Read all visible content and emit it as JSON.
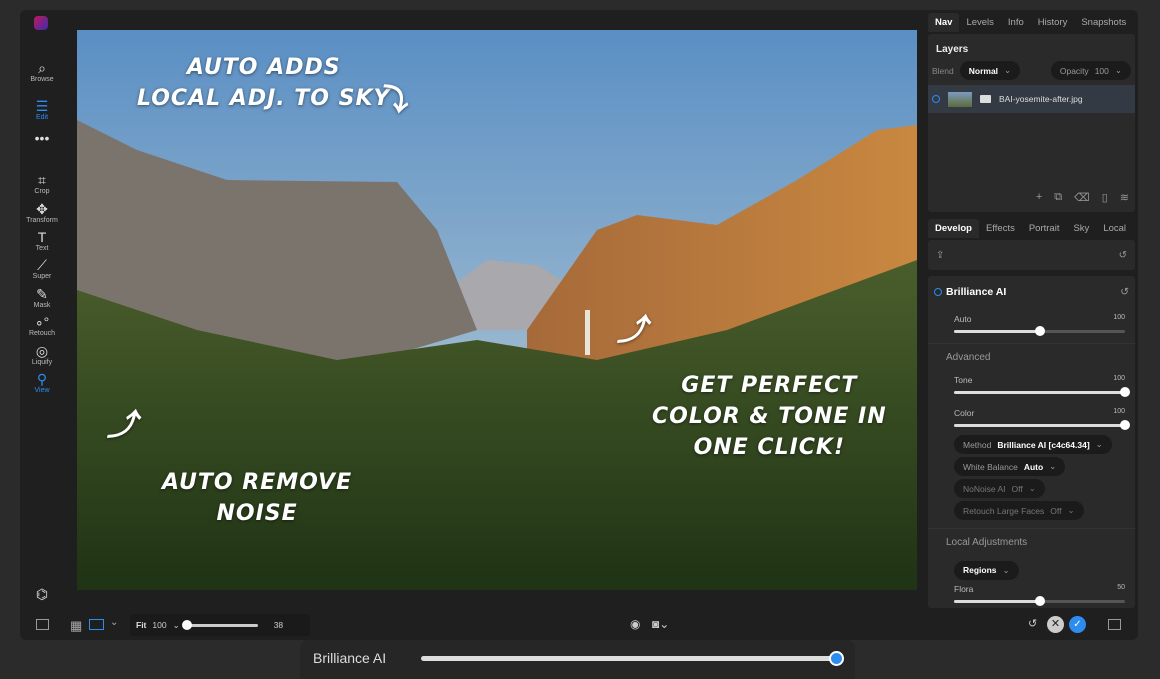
{
  "toolbar": {
    "tools": [
      {
        "label": "Browse",
        "icon": "browse-icon"
      },
      {
        "label": "Edit",
        "icon": "sliders-icon",
        "active": true
      },
      {
        "label": "Crop",
        "icon": "crop-icon"
      },
      {
        "label": "Transform",
        "icon": "move-icon"
      },
      {
        "label": "Text",
        "icon": "text-icon"
      },
      {
        "label": "Super",
        "icon": "magic-wand-icon"
      },
      {
        "label": "Mask",
        "icon": "mask-brush-icon"
      },
      {
        "label": "Retouch",
        "icon": "retouch-icon"
      },
      {
        "label": "Liquify",
        "icon": "liquify-icon"
      },
      {
        "label": "View",
        "icon": "view-icon",
        "active": true
      }
    ]
  },
  "annotations": {
    "sky": "AUTO ADDS\nLOCAL ADJ. TO SKY",
    "color": "GET PERFECT\nCOLOR & TONE IN\nONE CLICK!",
    "noise": "AUTO REMOVE\nNOISE"
  },
  "top_tabs": [
    "Nav",
    "Levels",
    "Info",
    "History",
    "Snapshots"
  ],
  "layers": {
    "title": "Layers",
    "blend_label": "Blend",
    "blend_value": "Normal",
    "opacity_label": "Opacity",
    "opacity_value": "100",
    "layer_name": "BAI-yosemite-after.jpg"
  },
  "dev_tabs": [
    "Develop",
    "Effects",
    "Portrait",
    "Sky",
    "Local"
  ],
  "brilliance": {
    "title": "Brilliance AI",
    "auto_label": "Auto",
    "auto_value": "100",
    "auto_fraction": 0.5,
    "advanced": "Advanced",
    "tone_label": "Tone",
    "tone_value": "100",
    "color_label": "Color",
    "color_value": "100",
    "method_label": "Method",
    "method_value": "Brilliance AI [c4c64.34]",
    "wb_label": "White Balance",
    "wb_value": "Auto",
    "nonoise_label": "NoNoise AI",
    "nonoise_value": "Off",
    "faces_label": "Retouch Large Faces",
    "faces_value": "Off",
    "local": "Local Adjustments",
    "regions": "Regions",
    "flora_label": "Flora",
    "flora_value": "50"
  },
  "bottom": {
    "fit": "Fit",
    "zoom": "100",
    "size_value": "38"
  },
  "floating": {
    "label": "Brilliance AI",
    "fraction": 1.0
  },
  "colors": {
    "accent": "#2d8cf0"
  }
}
